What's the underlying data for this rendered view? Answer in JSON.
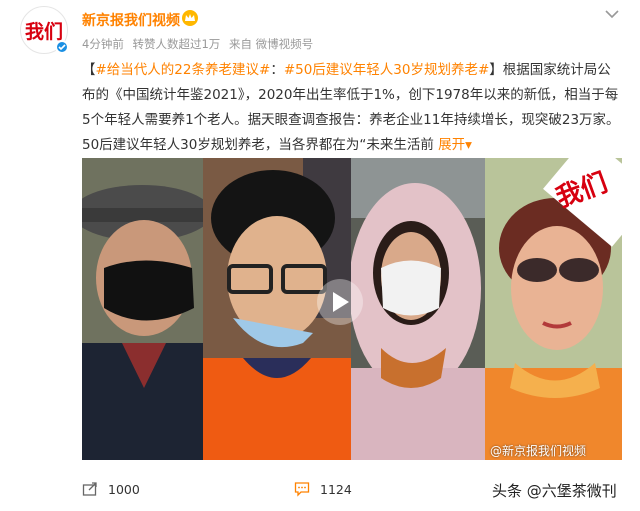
{
  "account": {
    "name": "新京报我们视频",
    "logo_text": "我们",
    "verified": true
  },
  "meta": {
    "time": "4分钟前",
    "reposts": "转赞人数超过1万",
    "source": "来自 微博视频号"
  },
  "post": {
    "prefix": "【",
    "tag1": "#给当代人的22条养老建议#",
    "sep": "：",
    "tag2": "#50后建议年轻人30岁规划养老#",
    "body": "】根据国家统计局公布的《中国统计年鉴2021》，2020年出生率低于1%，创下1978年以来的新低，相当于每5个年轻人需要养1个老人。据天眼查调查报告：养老企业11年持续增长，现突破23万家。50后建议年轻人30岁规划养老，当各界都在为“未来生活前 ",
    "expand": "展开",
    "expand_arrow": "▾"
  },
  "video": {
    "watermark": "@新京报我们视频",
    "corner_logo": "我们"
  },
  "actions": {
    "share_count": "1000",
    "comment_count": "1124"
  },
  "footer": {
    "source": "头条 @六堡茶微刊"
  },
  "colors": {
    "accent": "#ff8200",
    "logo_red": "#d7000f",
    "verified_blue": "#1a8fe3"
  }
}
